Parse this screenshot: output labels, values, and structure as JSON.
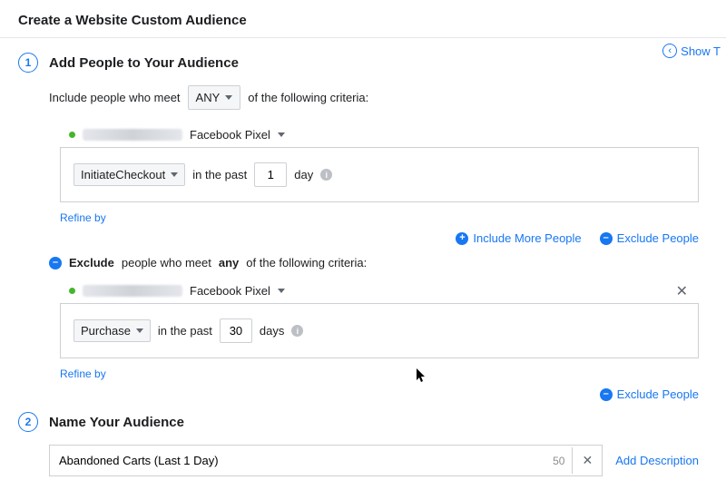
{
  "header": {
    "title": "Create a Website Custom Audience"
  },
  "show_tips_label": "Show T",
  "step1": {
    "number": "1",
    "title": "Add People to Your Audience",
    "include": {
      "prefix": "Include people who meet",
      "mode": "ANY",
      "suffix": "of the following criteria:",
      "pixel_label": "Facebook Pixel",
      "event": "InitiateCheckout",
      "past_label": "in the past",
      "days_value": "1",
      "days_unit": "day",
      "refine_label": "Refine by"
    },
    "exclude": {
      "prefix_strong": "Exclude",
      "prefix_rest": "people who meet",
      "any_word": "any",
      "suffix": "of the following criteria:",
      "pixel_label": "Facebook Pixel",
      "event": "Purchase",
      "past_label": "in the past",
      "days_value": "30",
      "days_unit": "days",
      "refine_label": "Refine by"
    },
    "actions": {
      "include_more": "Include More People",
      "exclude_people": "Exclude People"
    }
  },
  "step2": {
    "number": "2",
    "title": "Name Your Audience",
    "name_value": "Abandoned Carts (Last 1 Day)",
    "char_remaining": "50",
    "add_description": "Add Description"
  }
}
